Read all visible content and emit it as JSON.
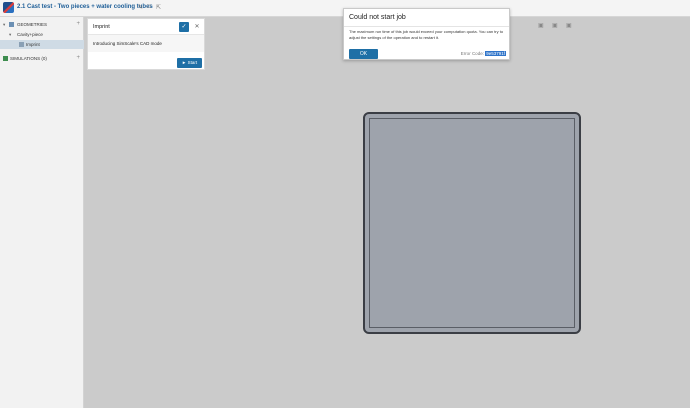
{
  "header": {
    "title": "2.1 Cast test - Two pieces + water cooling tubes"
  },
  "sidebar": {
    "geometries_label": "GEOMETRIES",
    "geometry_item": "Cavity+piece",
    "operation_item": "Imprint",
    "simulations_label": "SIMULATIONS (0)"
  },
  "panel": {
    "title": "Imprint",
    "description": "Introducing SimScale's CAD mode",
    "start_label": "Start"
  },
  "modal": {
    "title": "Could not start job",
    "message": "The maximum run time of this job would exceed your computation quota. You can try to adjust the settings of the operation and to restart it.",
    "ok_label": "OK",
    "error_label": "Error Code:",
    "error_code": "9e53791f"
  },
  "colors": {
    "accent": "#1e6fa6",
    "title": "#1f5f98"
  }
}
